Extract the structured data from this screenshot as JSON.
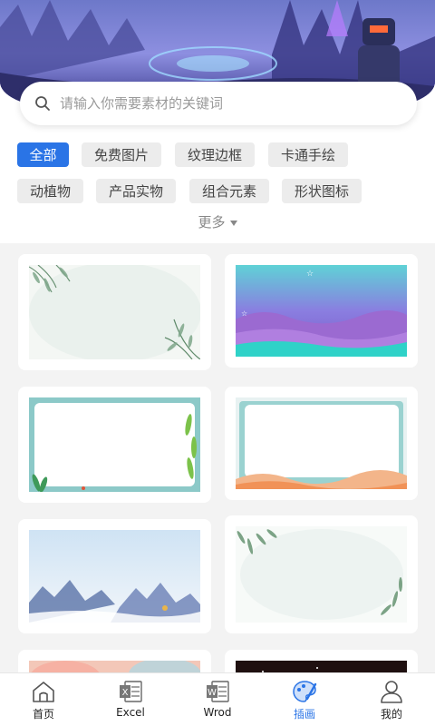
{
  "search": {
    "placeholder": "请输入你需要素材的关键词"
  },
  "categories": [
    {
      "label": "全部",
      "active": true
    },
    {
      "label": "免费图片",
      "active": false
    },
    {
      "label": "纹理边框",
      "active": false
    },
    {
      "label": "卡通手绘",
      "active": false
    },
    {
      "label": "动植物",
      "active": false
    },
    {
      "label": "产品实物",
      "active": false
    },
    {
      "label": "组合元素",
      "active": false
    },
    {
      "label": "形状图标",
      "active": false
    }
  ],
  "more_label": "更多",
  "templates": [
    {
      "style": "ink-leaf-border"
    },
    {
      "style": "purple-landscape"
    },
    {
      "style": "teal-plant-frame"
    },
    {
      "style": "orange-wave-frame"
    },
    {
      "style": "misty-mountains"
    },
    {
      "style": "willow-corner-frame"
    },
    {
      "style": "pastel-partial"
    },
    {
      "style": "dark-partial"
    }
  ],
  "nav": [
    {
      "label": "首页",
      "icon": "home-icon",
      "active": false
    },
    {
      "label": "Excel",
      "icon": "excel-icon",
      "active": false
    },
    {
      "label": "Wrod",
      "icon": "word-icon",
      "active": false
    },
    {
      "label": "插画",
      "icon": "palette-icon",
      "active": true
    },
    {
      "label": "我的",
      "icon": "user-icon",
      "active": false
    }
  ],
  "colors": {
    "accent": "#2a74e6",
    "chip_bg": "#ececec",
    "page_bg": "#f3f3f3"
  }
}
